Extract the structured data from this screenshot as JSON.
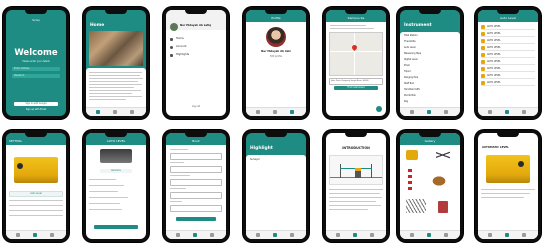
{
  "row1": {
    "login": {
      "app_name": "Survey",
      "title": "Welcome",
      "subtitle": "Please enter your details",
      "email_placeholder": "Enter Address",
      "password_placeholder": "Password",
      "signin_label": "Sign in with Google",
      "create_label": "Sign up with Email"
    },
    "home": {
      "title": "Home"
    },
    "profile_menu": {
      "name": "Nur Hidayah Ab Latiq",
      "items": [
        "Home",
        "Account",
        "Highlights"
      ],
      "logout": "Log out"
    },
    "profile": {
      "header": "Profile",
      "name": "Nur Hidayah Ab Aziz",
      "sub": "Edit profile"
    },
    "map": {
      "header": "Kampus Ke",
      "address_label": "Jalan Putra, Kampung Sungai Besar, 44000",
      "find_label": "Find instrument"
    },
    "instrument": {
      "title": "Instrument",
      "items": [
        "Total Station",
        "Theodolite",
        "Auto Level",
        "Measuring Tape",
        "Digital Level",
        "Prism",
        "Tripod",
        "Ranging Pole",
        "Staff Rod",
        "Handheld GPS",
        "Plumb Bob",
        "Peg"
      ]
    },
    "list": {
      "header": "Auto Level",
      "items": [
        "AUTO LEVEL",
        "AUTO LEVEL",
        "AUTO LEVEL",
        "AUTO LEVEL",
        "AUTO LEVEL",
        "AUTO LEVEL",
        "AUTO LEVEL",
        "AUTO LEVEL",
        "AUTO LEVEL"
      ]
    }
  },
  "row2": {
    "detail": {
      "header": "SETTING",
      "caption": "Auto Level"
    },
    "detail2": {
      "header": "AUTO LEVEL",
      "button": "Remarks"
    },
    "form": {
      "header": "Book"
    },
    "highlight": {
      "title": "Highlight",
      "item": "Surveyor"
    },
    "intro": {
      "title": "INTRODUCTION"
    },
    "gallery": {
      "header": "Gallery"
    },
    "automatic": {
      "title": "AUTOMATIC LEVEL"
    }
  }
}
